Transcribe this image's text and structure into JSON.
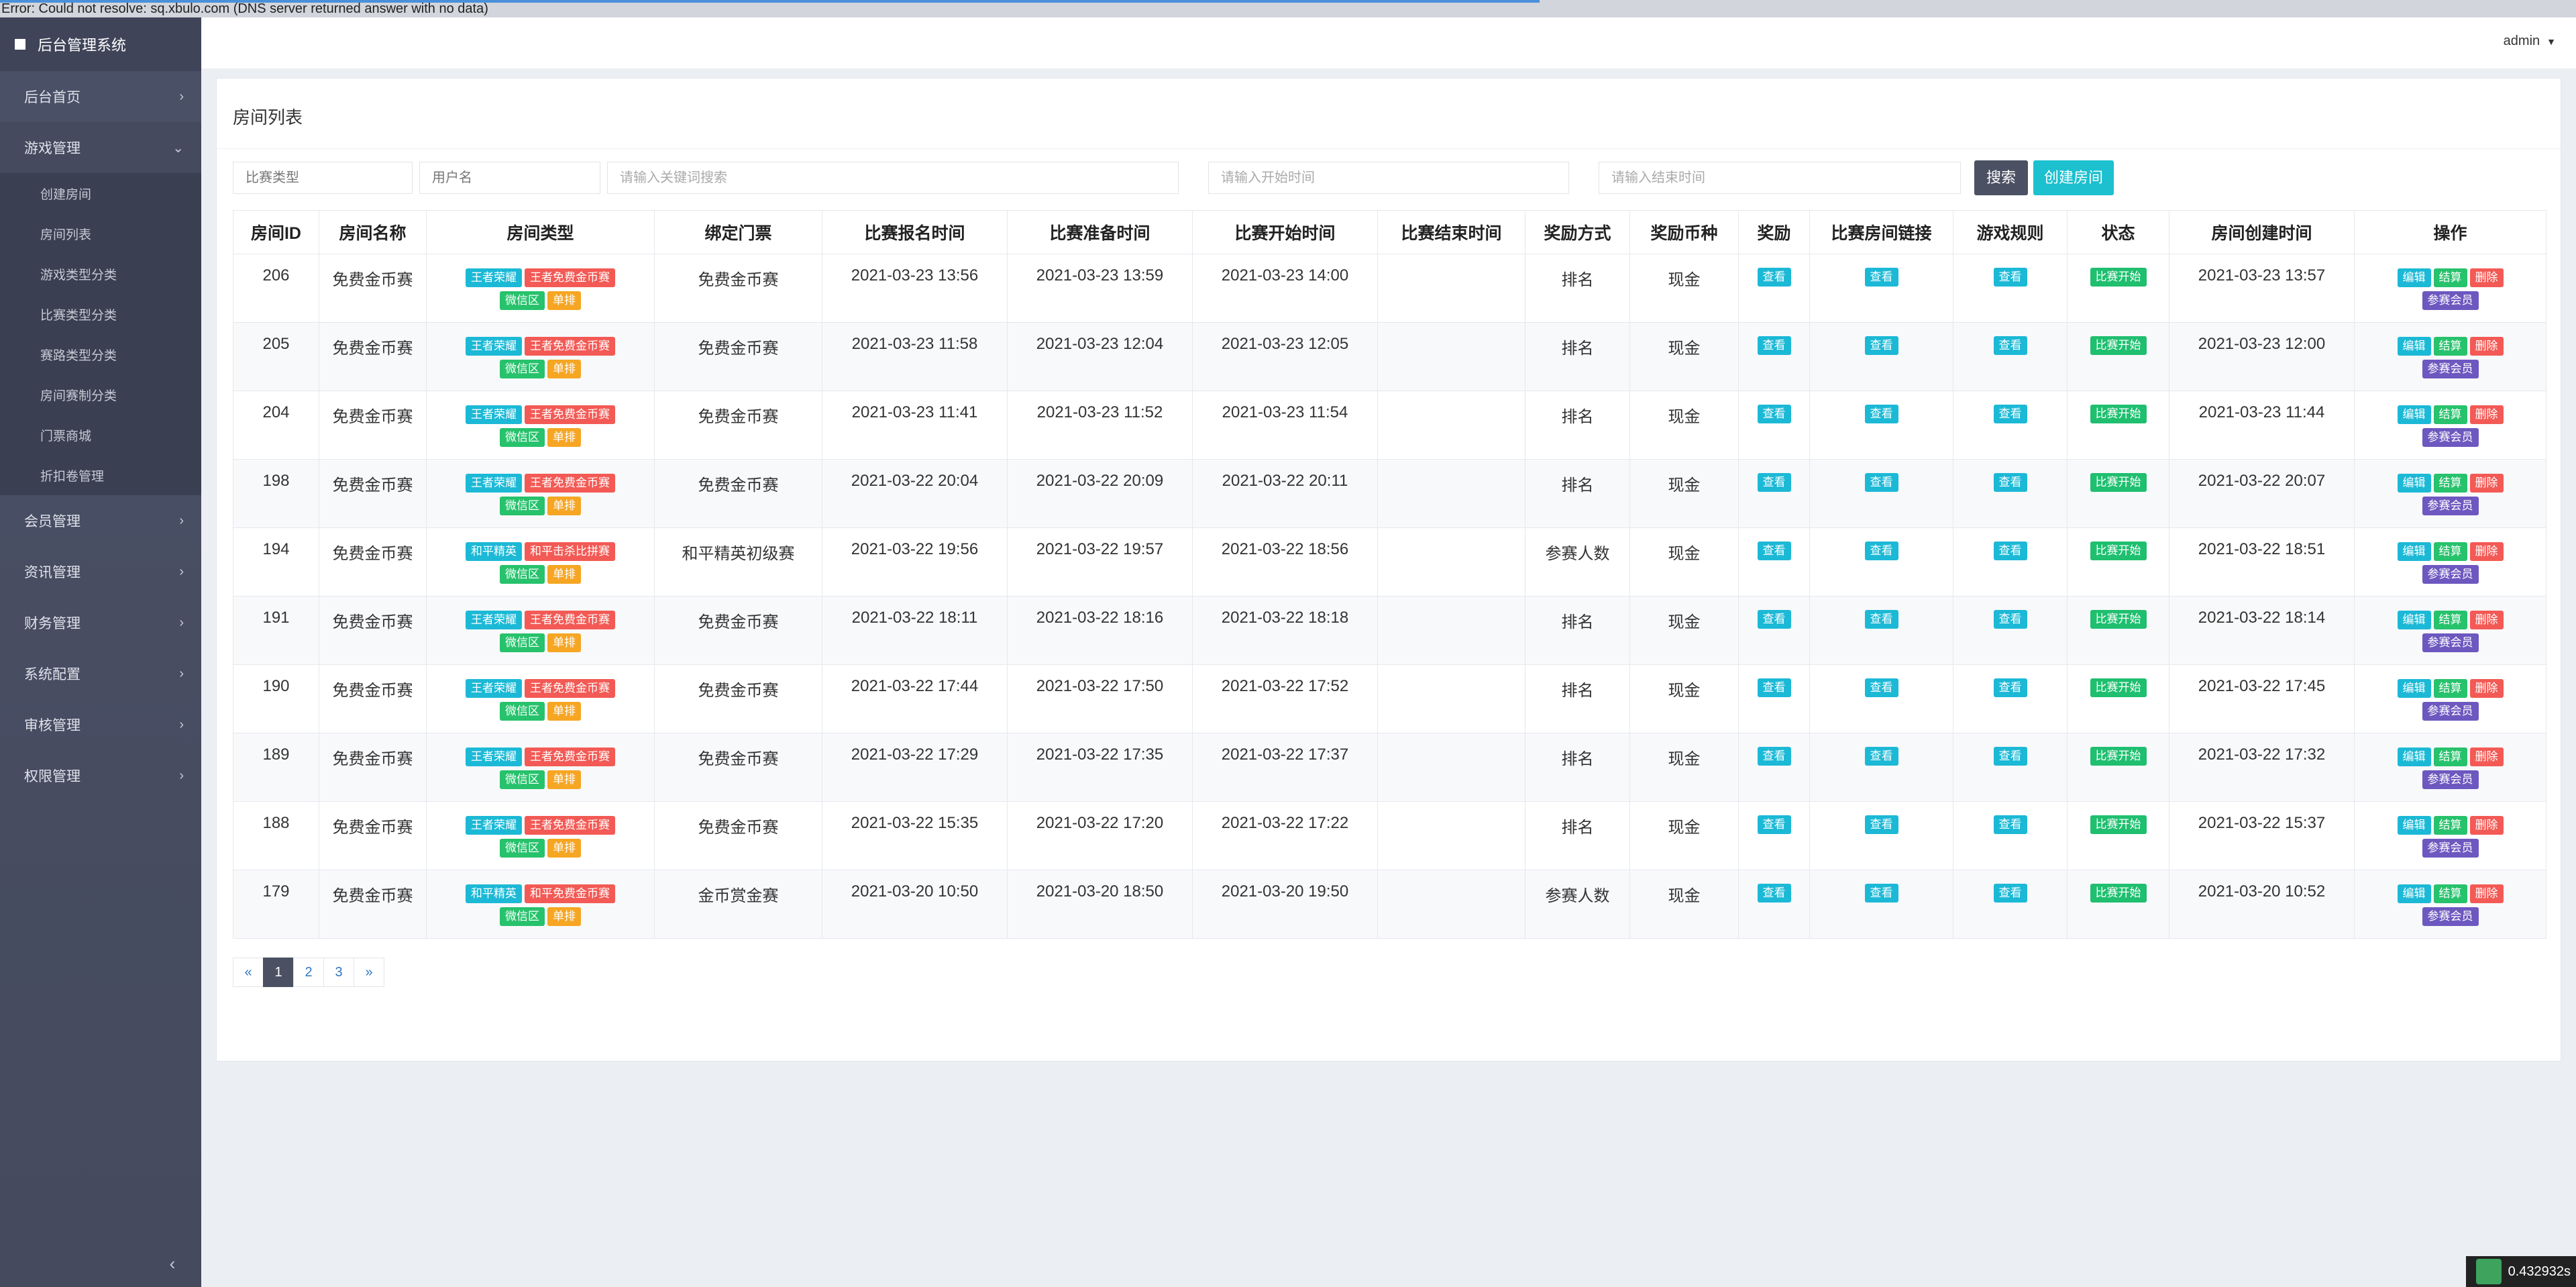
{
  "error_banner": "Error: Could not resolve: sq.xbulo.com (DNS server returned answer with no data)",
  "brand": "后台管理系统",
  "user": "admin",
  "nav": [
    {
      "label": "后台首页",
      "open": false
    },
    {
      "label": "游戏管理",
      "open": true,
      "children": [
        "创建房间",
        "房间列表",
        "游戏类型分类",
        "比赛类型分类",
        "赛路类型分类",
        "房间赛制分类",
        "门票商城",
        "折扣卷管理"
      ]
    },
    {
      "label": "会员管理",
      "open": false
    },
    {
      "label": "资讯管理",
      "open": false
    },
    {
      "label": "财务管理",
      "open": false
    },
    {
      "label": "系统配置",
      "open": false
    },
    {
      "label": "审核管理",
      "open": false
    },
    {
      "label": "权限管理",
      "open": false
    }
  ],
  "panel_title": "房间列表",
  "filters": {
    "match_type": "比赛类型",
    "username": "用户名",
    "keyword_placeholder": "请输入关键词搜索",
    "start_placeholder": "请输入开始时间",
    "end_placeholder": "请输入结束时间",
    "search_btn": "搜索",
    "create_btn": "创建房间"
  },
  "columns": [
    "房间ID",
    "房间名称",
    "房间类型",
    "绑定门票",
    "比赛报名时间",
    "比赛准备时间",
    "比赛开始时间",
    "比赛结束时间",
    "奖励方式",
    "奖励币种",
    "奖励",
    "比赛房间链接",
    "游戏规则",
    "状态",
    "房间创建时间",
    "操作"
  ],
  "labels": {
    "view": "查看",
    "status": "比赛开始",
    "edit": "编辑",
    "settle": "结算",
    "delete": "删除",
    "members": "参赛会员"
  },
  "rows": [
    {
      "id": "206",
      "name": "免费金币赛",
      "tags": [
        "王者荣耀",
        "王者免费金币赛",
        "微信区",
        "单排"
      ],
      "ticket": "免费金币赛",
      "signup": "2021-03-23 13:56",
      "prep": "2021-03-23 13:59",
      "start": "2021-03-23 14:00",
      "end": "",
      "reward_mode": "排名",
      "currency": "现金",
      "created": "2021-03-23 13:57"
    },
    {
      "id": "205",
      "name": "免费金币赛",
      "tags": [
        "王者荣耀",
        "王者免费金币赛",
        "微信区",
        "单排"
      ],
      "ticket": "免费金币赛",
      "signup": "2021-03-23 11:58",
      "prep": "2021-03-23 12:04",
      "start": "2021-03-23 12:05",
      "end": "",
      "reward_mode": "排名",
      "currency": "现金",
      "created": "2021-03-23 12:00"
    },
    {
      "id": "204",
      "name": "免费金币赛",
      "tags": [
        "王者荣耀",
        "王者免费金币赛",
        "微信区",
        "单排"
      ],
      "ticket": "免费金币赛",
      "signup": "2021-03-23 11:41",
      "prep": "2021-03-23 11:52",
      "start": "2021-03-23 11:54",
      "end": "",
      "reward_mode": "排名",
      "currency": "现金",
      "created": "2021-03-23 11:44"
    },
    {
      "id": "198",
      "name": "免费金币赛",
      "tags": [
        "王者荣耀",
        "王者免费金币赛",
        "微信区",
        "单排"
      ],
      "ticket": "免费金币赛",
      "signup": "2021-03-22 20:04",
      "prep": "2021-03-22 20:09",
      "start": "2021-03-22 20:11",
      "end": "",
      "reward_mode": "排名",
      "currency": "现金",
      "created": "2021-03-22 20:07"
    },
    {
      "id": "194",
      "name": "免费金币赛",
      "tags": [
        "和平精英",
        "和平击杀比拼赛",
        "微信区",
        "单排"
      ],
      "ticket": "和平精英初级赛",
      "signup": "2021-03-22 19:56",
      "prep": "2021-03-22 19:57",
      "start": "2021-03-22 18:56",
      "end": "",
      "reward_mode": "参赛人数",
      "currency": "现金",
      "created": "2021-03-22 18:51"
    },
    {
      "id": "191",
      "name": "免费金币赛",
      "tags": [
        "王者荣耀",
        "王者免费金币赛",
        "微信区",
        "单排"
      ],
      "ticket": "免费金币赛",
      "signup": "2021-03-22 18:11",
      "prep": "2021-03-22 18:16",
      "start": "2021-03-22 18:18",
      "end": "",
      "reward_mode": "排名",
      "currency": "现金",
      "created": "2021-03-22 18:14"
    },
    {
      "id": "190",
      "name": "免费金币赛",
      "tags": [
        "王者荣耀",
        "王者免费金币赛",
        "微信区",
        "单排"
      ],
      "ticket": "免费金币赛",
      "signup": "2021-03-22 17:44",
      "prep": "2021-03-22 17:50",
      "start": "2021-03-22 17:52",
      "end": "",
      "reward_mode": "排名",
      "currency": "现金",
      "created": "2021-03-22 17:45"
    },
    {
      "id": "189",
      "name": "免费金币赛",
      "tags": [
        "王者荣耀",
        "王者免费金币赛",
        "微信区",
        "单排"
      ],
      "ticket": "免费金币赛",
      "signup": "2021-03-22 17:29",
      "prep": "2021-03-22 17:35",
      "start": "2021-03-22 17:37",
      "end": "",
      "reward_mode": "排名",
      "currency": "现金",
      "created": "2021-03-22 17:32"
    },
    {
      "id": "188",
      "name": "免费金币赛",
      "tags": [
        "王者荣耀",
        "王者免费金币赛",
        "微信区",
        "单排"
      ],
      "ticket": "免费金币赛",
      "signup": "2021-03-22 15:35",
      "prep": "2021-03-22 17:20",
      "start": "2021-03-22 17:22",
      "end": "",
      "reward_mode": "排名",
      "currency": "现金",
      "created": "2021-03-22 15:37"
    },
    {
      "id": "179",
      "name": "免费金币赛",
      "tags": [
        "和平精英",
        "和平免费金币赛",
        "微信区",
        "单排"
      ],
      "ticket": "金币赏金赛",
      "signup": "2021-03-20 10:50",
      "prep": "2021-03-20 18:50",
      "start": "2021-03-20 19:50",
      "end": "",
      "reward_mode": "参赛人数",
      "currency": "现金",
      "created": "2021-03-20 10:52"
    }
  ],
  "pagination": {
    "prev": "«",
    "pages": [
      "1",
      "2",
      "3"
    ],
    "active": "1",
    "next": "»"
  },
  "timer": "0.432932s",
  "colors": {
    "sidebar": "#4a5066",
    "accent": "#1cc0cf",
    "search_btn": "#4b5163",
    "danger": "#f35a55",
    "success": "#27c26c",
    "warning": "#f6a623",
    "purple": "#6d58c0"
  }
}
